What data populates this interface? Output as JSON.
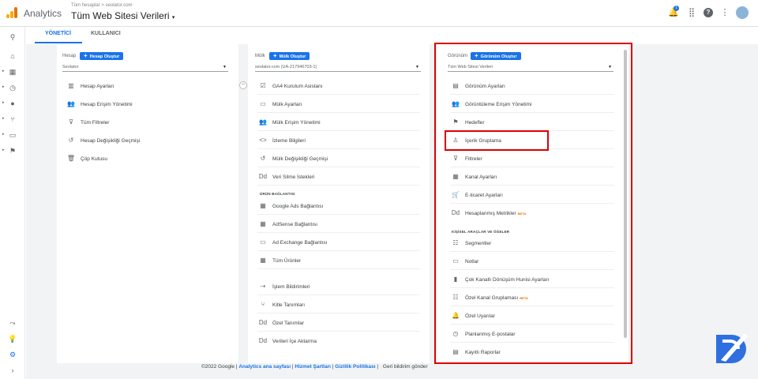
{
  "app": {
    "name": "Analytics",
    "breadcrumb": "Tüm hesaplar > seolator.com",
    "property": "Tüm Web Sitesi Verileri"
  },
  "topbar_icons": [
    "bell-icon",
    "apps-icon",
    "help-icon",
    "more-vert-icon",
    "avatar"
  ],
  "notification_count": "1",
  "tabs": [
    {
      "label": "YÖNETİCİ"
    },
    {
      "label": "KULLANICI"
    }
  ],
  "account": {
    "heading": "Hesap",
    "create_label": "Hesap Oluştur",
    "selected": "Seolator",
    "items": [
      {
        "label": "Hesap Ayarları",
        "icon": "building-icon"
      },
      {
        "label": "Hesap Erişim Yönetimi",
        "icon": "people-icon"
      },
      {
        "label": "Tüm Filtreler",
        "icon": "filter-icon"
      },
      {
        "label": "Hesap Değişikliği Geçmişi",
        "icon": "history-icon"
      },
      {
        "label": "Çöp Kutusu",
        "icon": "trash-icon"
      }
    ]
  },
  "property": {
    "heading": "Mülk",
    "create_label": "Mülk Oluştur",
    "selected": "seolator.com (UA-217946703-1)",
    "items": [
      {
        "label": "GA4 Kurulum Asistanı",
        "icon": "checkbox-icon"
      },
      {
        "label": "Mülk Ayarları",
        "icon": "window-icon"
      },
      {
        "label": "Mülk Erişim Yönetimi",
        "icon": "people-icon"
      },
      {
        "label": "İzleme Bilgileri",
        "icon": "code-icon"
      },
      {
        "label": "Mülk Değişikliği Geçmişi",
        "icon": "history-icon"
      },
      {
        "label": "Veri Silme İstekleri",
        "icon": "dd-icon"
      }
    ],
    "section_label": "ÜRÜN BAĞLANTISI",
    "links": [
      {
        "label": "Google Ads Bağlantısı",
        "icon": "grid-icon"
      },
      {
        "label": "AdSense Bağlantısı",
        "icon": "grid-icon"
      },
      {
        "label": "Ad Exchange Bağlantısı",
        "icon": "window-icon"
      },
      {
        "label": "Tüm Ürünler",
        "icon": "grid-icon"
      }
    ],
    "others": [
      {
        "label": "İşlem Bildirimleri",
        "icon": "arrow-icon"
      },
      {
        "label": "Kitle Tanımları",
        "icon": "fork-icon"
      },
      {
        "label": "Özel Tanımlar",
        "icon": "dd-icon"
      },
      {
        "label": "Verileri İçe Aktarma",
        "icon": "dd-icon"
      }
    ]
  },
  "view": {
    "heading": "Görünüm",
    "create_label": "Görünüm Oluştur",
    "selected": "Tüm Web Sitesi Verileri",
    "items": [
      {
        "label": "Görünüm Ayarları",
        "icon": "doc-icon"
      },
      {
        "label": "Görüntüleme Erişim Yönetimi",
        "icon": "people-icon"
      },
      {
        "label": "Hedefler",
        "icon": "flag-icon"
      },
      {
        "label": "İçerik Gruplama",
        "icon": "person-icon"
      },
      {
        "label": "Filtreler",
        "icon": "filter-icon"
      },
      {
        "label": "Kanal Ayarları",
        "icon": "grid-icon"
      },
      {
        "label": "E-ticaret Ayarları",
        "icon": "cart-icon"
      },
      {
        "label": "Hesaplanmış Metrikler",
        "icon": "dd-icon",
        "badge": "BETA"
      }
    ],
    "section_label": "KİŞİSEL ARAÇLAR VE ÖĞELER",
    "tools": [
      {
        "label": "Segmentler",
        "icon": "segment-icon"
      },
      {
        "label": "Notlar",
        "icon": "note-icon"
      },
      {
        "label": "Çok Kanallı Dönüşüm Hunisi Ayarları",
        "icon": "bar-icon"
      },
      {
        "label": "Özel Kanal Gruplaması",
        "icon": "segment-icon",
        "badge": "BETA"
      },
      {
        "label": "Özel Uyarılar",
        "icon": "bell-icon"
      },
      {
        "label": "Planlanmış E-postalar",
        "icon": "clock-icon"
      },
      {
        "label": "Kayıtlı Raporlar",
        "icon": "doc-icon"
      }
    ]
  },
  "footer": {
    "copyright": "©2022 Google |",
    "home": "Analytics ana sayfası",
    "sep1": "|",
    "terms": "Hizmet Şartları",
    "sep2": "|",
    "privacy": "Gizlilik Politikası",
    "sep3": "|",
    "feedback": "Geri bildirim gönder"
  },
  "colors": {
    "accent": "#1a73e8",
    "highlight": "#dd0000",
    "logo_orange": "#f9ab00",
    "logo_dark": "#e37400"
  }
}
